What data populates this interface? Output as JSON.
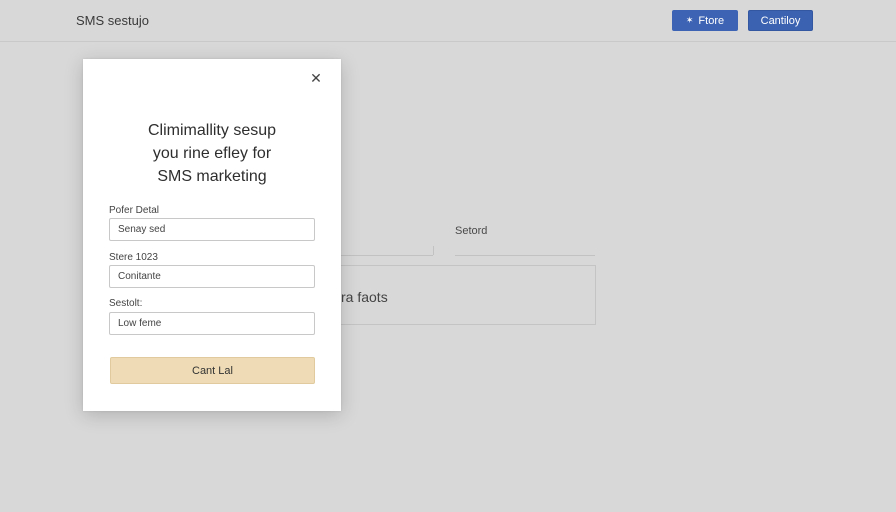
{
  "header": {
    "title": "SMS sestujo",
    "primary_button": {
      "icon": "pin-icon",
      "label": "Ftore"
    },
    "secondary_button": {
      "label": "Cantiloy"
    }
  },
  "background": {
    "field_label": "Setord",
    "box_text": "ra faots"
  },
  "modal": {
    "heading_lines": [
      "Climimallity sesup",
      "you rine efley for",
      "SMS marketing"
    ],
    "fields": [
      {
        "label": "Pofer Detal",
        "value": "Senay sed"
      },
      {
        "label": "Stere 1023",
        "value": "Conitante"
      },
      {
        "label": "Sestolt:",
        "value": "Low feme"
      }
    ],
    "submit_label": "Cant Lal",
    "close_icon": "close-icon"
  },
  "colors": {
    "accent_blue": "#3d64b4",
    "cta_fill": "#efdcb6",
    "backdrop": "#d8d8d8"
  }
}
